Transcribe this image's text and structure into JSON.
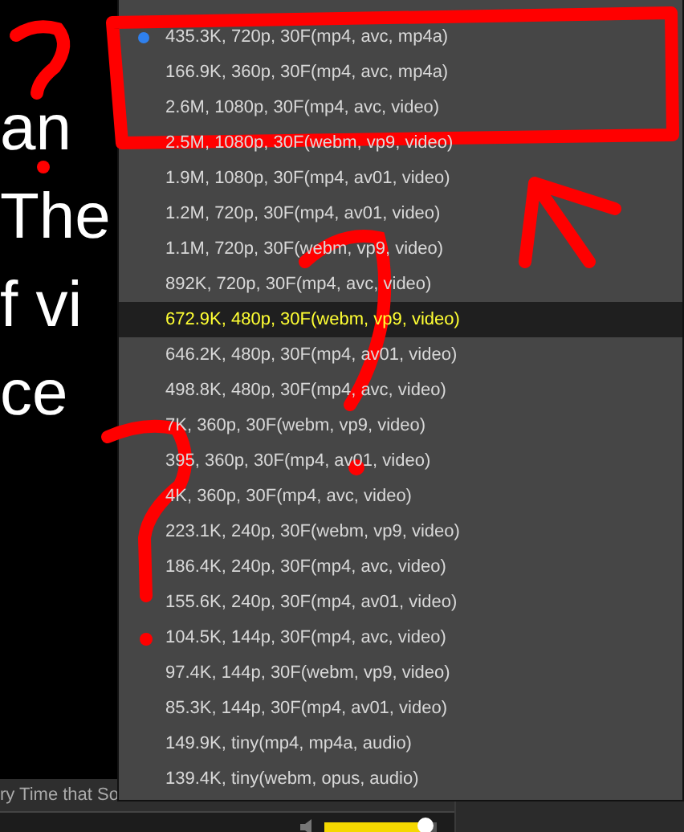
{
  "video": {
    "caption_lines": [
      "an",
      "The",
      "f vi",
      "ce"
    ]
  },
  "quality_menu": {
    "items": [
      {
        "label": "435.3K, 720p, 30F(mp4, avc, mp4a)",
        "checked": true,
        "selected": false
      },
      {
        "label": "166.9K, 360p, 30F(mp4, avc, mp4a)",
        "checked": false,
        "selected": false
      },
      {
        "label": "2.6M, 1080p, 30F(mp4, avc, video)",
        "checked": false,
        "selected": false
      },
      {
        "label": "2.5M, 1080p, 30F(webm, vp9, video)",
        "checked": false,
        "selected": false
      },
      {
        "label": "1.9M, 1080p, 30F(mp4, av01, video)",
        "checked": false,
        "selected": false
      },
      {
        "label": "1.2M, 720p, 30F(mp4, av01, video)",
        "checked": false,
        "selected": false
      },
      {
        "label": "1.1M, 720p, 30F(webm, vp9, video)",
        "checked": false,
        "selected": false
      },
      {
        "label": "892K, 720p, 30F(mp4, avc, video)",
        "checked": false,
        "selected": false
      },
      {
        "label": "672.9K, 480p, 30F(webm, vp9, video)",
        "checked": false,
        "selected": true
      },
      {
        "label": "646.2K, 480p, 30F(mp4, av01, video)",
        "checked": false,
        "selected": false
      },
      {
        "label": "498.8K, 480p, 30F(mp4, avc, video)",
        "checked": false,
        "selected": false
      },
      {
        "label": "7K, 360p, 30F(webm, vp9, video)",
        "checked": false,
        "selected": false
      },
      {
        "label": "395, 360p, 30F(mp4, av01, video)",
        "checked": false,
        "selected": false
      },
      {
        "label": "4K, 360p, 30F(mp4, avc, video)",
        "checked": false,
        "selected": false
      },
      {
        "label": "223.1K, 240p, 30F(webm, vp9, video)",
        "checked": false,
        "selected": false
      },
      {
        "label": "186.4K, 240p, 30F(mp4, avc, video)",
        "checked": false,
        "selected": false
      },
      {
        "label": "155.6K, 240p, 30F(mp4, av01, video)",
        "checked": false,
        "selected": false
      },
      {
        "label": "104.5K, 144p, 30F(mp4, avc, video)",
        "checked": false,
        "selected": false
      },
      {
        "label": "97.4K, 144p, 30F(webm, vp9, video)",
        "checked": false,
        "selected": false
      },
      {
        "label": "85.3K, 144p, 30F(mp4, av01, video)",
        "checked": false,
        "selected": false
      },
      {
        "label": "149.9K, tiny(mp4, mp4a, audio)",
        "checked": false,
        "selected": false
      },
      {
        "label": "139.4K, tiny(webm, opus, audio)",
        "checked": false,
        "selected": false
      }
    ]
  },
  "title_strip": {
    "text": "ry Time that So"
  },
  "volume": {
    "level": 0.9
  }
}
